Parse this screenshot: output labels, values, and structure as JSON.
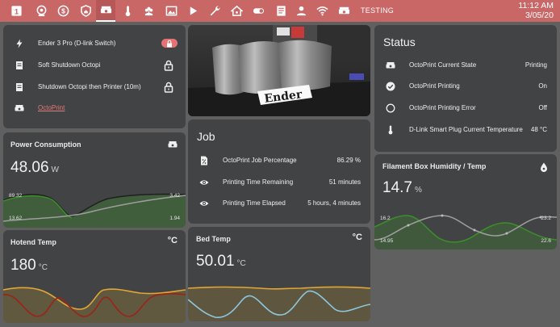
{
  "topbar": {
    "tabs": [
      {
        "label": "1",
        "icon": "numeric-1-box-icon"
      },
      {
        "label": "",
        "icon": "camera-badge-icon"
      },
      {
        "label": "$",
        "icon": "dollar-circle-icon"
      },
      {
        "label": "",
        "icon": "shield-home-icon"
      },
      {
        "label": "",
        "icon": "octoprint-printer-icon"
      },
      {
        "label": "",
        "icon": "thermometer-icon"
      },
      {
        "label": "",
        "icon": "flower-icon"
      },
      {
        "label": "",
        "icon": "image-map-icon"
      },
      {
        "label": "",
        "icon": "play-icon"
      },
      {
        "label": "",
        "icon": "wrench-icon"
      },
      {
        "label": "",
        "icon": "home-automation-icon"
      },
      {
        "label": "",
        "icon": "toggle-switch-icon"
      },
      {
        "label": "",
        "icon": "document-list-icon"
      },
      {
        "label": "",
        "icon": "account-icon"
      },
      {
        "label": "",
        "icon": "wifi-icon"
      },
      {
        "label": "",
        "icon": "octoprint-icon"
      }
    ],
    "active_tab_text": "TESTING",
    "time": "11:12 AM",
    "date": "3/05/20"
  },
  "controls_card": {
    "rows": [
      {
        "label": "Ender 3 Pro (D-link Switch)",
        "icon": "flash-icon",
        "control": "toggle"
      },
      {
        "label": "Soft Shutdown Octopi",
        "icon": "script-icon",
        "control": "lock"
      },
      {
        "label": "Shutdown Octopi then Printer (10m)",
        "icon": "script-icon",
        "control": "lock"
      },
      {
        "label": "OctoPrint",
        "icon": "octoprint-icon",
        "control": "link"
      }
    ]
  },
  "camera": {
    "printed_text": "Ender"
  },
  "power": {
    "title": "Power Consumption",
    "value": "48.06",
    "unit": "W",
    "labels": {
      "max_left": "89.32",
      "min_left": "13.62",
      "max_right": "3.42",
      "min_right": "1.94"
    },
    "colors": {
      "primary": "#3b8f2a",
      "secondary": "#9e9e9e"
    }
  },
  "hotend": {
    "title": "Hotend Temp",
    "value": "180",
    "unit": "°C",
    "colors": {
      "primary": "#e2a735",
      "secondary": "#9b2417"
    }
  },
  "bed": {
    "title": "Bed Temp",
    "value": "50.01",
    "unit": "°C",
    "colors": {
      "primary": "#e2a735",
      "secondary": "#8cc7de"
    }
  },
  "job": {
    "title": "Job",
    "rows": [
      {
        "label": "OctoPrint Job Percentage",
        "value": "86.29 %",
        "icon": "file-percent-icon"
      },
      {
        "label": "Printing Time Remaining",
        "value": "51 minutes",
        "icon": "eye-icon"
      },
      {
        "label": "Printing Time Elapsed",
        "value": "5 hours, 4 minutes",
        "icon": "eye-icon"
      }
    ]
  },
  "status": {
    "title": "Status",
    "rows": [
      {
        "label": "OctoPrint Current State",
        "value": "Printing",
        "icon": "octoprint-icon"
      },
      {
        "label": "OctoPrint Printing",
        "value": "On",
        "icon": "check-circle-icon"
      },
      {
        "label": "OctoPrint Printing Error",
        "value": "Off",
        "icon": "circle-outline-icon"
      },
      {
        "label": "D-Link Smart Plug Current Temperature",
        "value": "48 °C",
        "icon": "thermometer-icon"
      }
    ]
  },
  "humidity": {
    "title": "Filament Box Humidity / Temp",
    "value": "14.7",
    "unit": "%",
    "labels": {
      "max_left": "16.2",
      "min_left": "14.95",
      "max_right": "23.2",
      "min_right": "22.6"
    },
    "colors": {
      "primary": "#3b8f2a",
      "secondary": "#9e9e9e"
    }
  }
}
